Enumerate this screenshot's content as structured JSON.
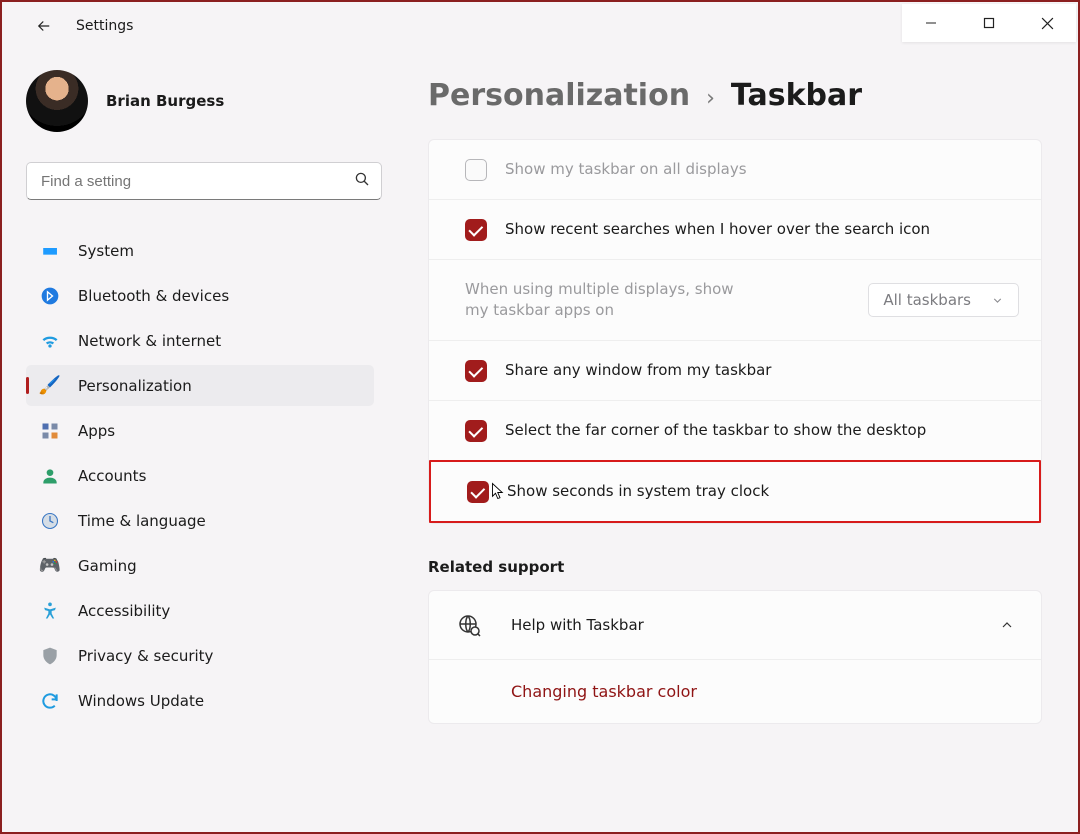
{
  "titlebar": {
    "app_name": "Settings"
  },
  "user": {
    "name": "Brian Burgess"
  },
  "search": {
    "placeholder": "Find a setting"
  },
  "sidebar": {
    "items": [
      {
        "label": "System"
      },
      {
        "label": "Bluetooth & devices"
      },
      {
        "label": "Network & internet"
      },
      {
        "label": "Personalization"
      },
      {
        "label": "Apps"
      },
      {
        "label": "Accounts"
      },
      {
        "label": "Time & language"
      },
      {
        "label": "Gaming"
      },
      {
        "label": "Accessibility"
      },
      {
        "label": "Privacy & security"
      },
      {
        "label": "Windows Update"
      }
    ]
  },
  "breadcrumb": {
    "parent": "Personalization",
    "current": "Taskbar"
  },
  "settings": {
    "show_all_displays": "Show my taskbar on all displays",
    "recent_searches": "Show recent searches when I hover over the search icon",
    "multi_display_label": "When using multiple displays, show my taskbar apps on",
    "multi_display_value": "All taskbars",
    "share_window": "Share any window from my taskbar",
    "far_corner": "Select the far corner of the taskbar to show the desktop",
    "show_seconds": "Show seconds in system tray clock"
  },
  "related": {
    "heading": "Related support",
    "help_label": "Help with Taskbar",
    "link1": "Changing taskbar color"
  }
}
